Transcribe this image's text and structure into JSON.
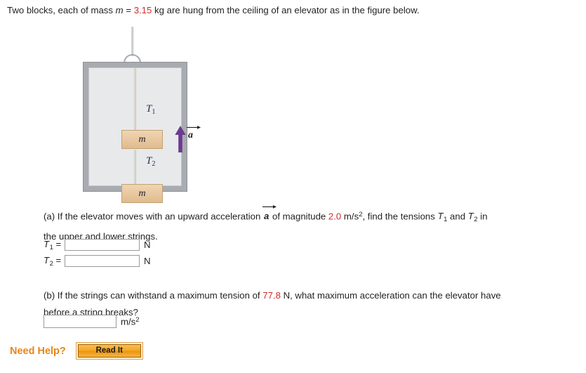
{
  "prompt": {
    "text_before_m": "Two blocks, each of mass ",
    "mass_symbol": "m",
    "equals": " = ",
    "mass_value": "3.15",
    "text_after_mass": " kg are hung from the ceiling of an elevator as in the figure below."
  },
  "figure": {
    "label_t1": "T",
    "label_t1_sub": "1",
    "label_t2": "T",
    "label_t2_sub": "2",
    "block_upper_label": "m",
    "block_lower_label": "m",
    "accel_label": "a",
    "colors": {
      "block_fill": "#e7c79e",
      "block_border": "#c2a274",
      "elevator_frame": "#a8abb0",
      "elevator_interior": "#e8e9eb",
      "arrow": "#6d3a8f",
      "label_text": "#2c2f4a",
      "string": "#d8d4cd"
    }
  },
  "part_a": {
    "marker": "(a)",
    "text_1": " If the elevator moves with an upward acceleration ",
    "accel_symbol": "a",
    "text_2": " of magnitude ",
    "accel_value": "2.0",
    "accel_unit": " m/s",
    "accel_unit_exp": "2",
    "text_3": ", find the tensions ",
    "tension_1": "T",
    "tension_1_sub": "1",
    "text_4": " and ",
    "tension_2": "T",
    "tension_2_sub": "2",
    "text_5": " in",
    "line_2": "the upper and lower strings.",
    "answers": [
      {
        "label": "T",
        "label_sub": "1",
        "equals": "=",
        "value": "",
        "placeholder": "",
        "unit": "N"
      },
      {
        "label": "T",
        "label_sub": "2",
        "equals": "=",
        "value": "",
        "placeholder": "",
        "unit": "N"
      }
    ]
  },
  "part_b": {
    "marker": "(b)",
    "text_1": " If the strings can withstand a maximum tension of ",
    "tension_value": "77.8",
    "text_2": " N, what maximum acceleration can the elevator have",
    "line_2": "before a string breaks?",
    "answer": {
      "value": "",
      "placeholder": "",
      "unit": "m/s",
      "unit_exp": "2"
    }
  },
  "need_help": {
    "label": "Need Help?",
    "button_label": "Read It",
    "accent_color": "#e8851a"
  }
}
